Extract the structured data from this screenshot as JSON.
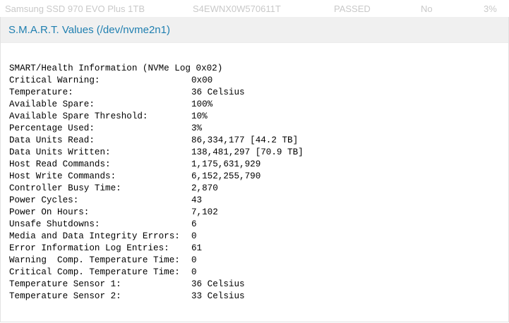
{
  "device_row": {
    "device": "Samsung SSD 970 EVO Plus 1TB",
    "serial": "S4EWNX0W570611T",
    "status": "PASSED",
    "flag": "No",
    "used": "3%"
  },
  "panel": {
    "title": "S.M.A.R.T. Values (/dev/nvme2n1)"
  },
  "smart": {
    "heading": "SMART/Health Information (NVMe Log 0x02)",
    "rows": [
      {
        "label": "Critical Warning:",
        "value": "0x00"
      },
      {
        "label": "Temperature:",
        "value": "36 Celsius"
      },
      {
        "label": "Available Spare:",
        "value": "100%"
      },
      {
        "label": "Available Spare Threshold:",
        "value": "10%"
      },
      {
        "label": "Percentage Used:",
        "value": "3%"
      },
      {
        "label": "Data Units Read:",
        "value": "86,334,177 [44.2 TB]"
      },
      {
        "label": "Data Units Written:",
        "value": "138,481,297 [70.9 TB]"
      },
      {
        "label": "Host Read Commands:",
        "value": "1,175,631,929"
      },
      {
        "label": "Host Write Commands:",
        "value": "6,152,255,790"
      },
      {
        "label": "Controller Busy Time:",
        "value": "2,870"
      },
      {
        "label": "Power Cycles:",
        "value": "43"
      },
      {
        "label": "Power On Hours:",
        "value": "7,102"
      },
      {
        "label": "Unsafe Shutdowns:",
        "value": "6"
      },
      {
        "label": "Media and Data Integrity Errors:",
        "value": "0"
      },
      {
        "label": "Error Information Log Entries:",
        "value": "61"
      },
      {
        "label": "Warning  Comp. Temperature Time:",
        "value": "0"
      },
      {
        "label": "Critical Comp. Temperature Time:",
        "value": "0"
      },
      {
        "label": "Temperature Sensor 1:",
        "value": "36 Celsius"
      },
      {
        "label": "Temperature Sensor 2:",
        "value": "33 Celsius"
      }
    ]
  }
}
